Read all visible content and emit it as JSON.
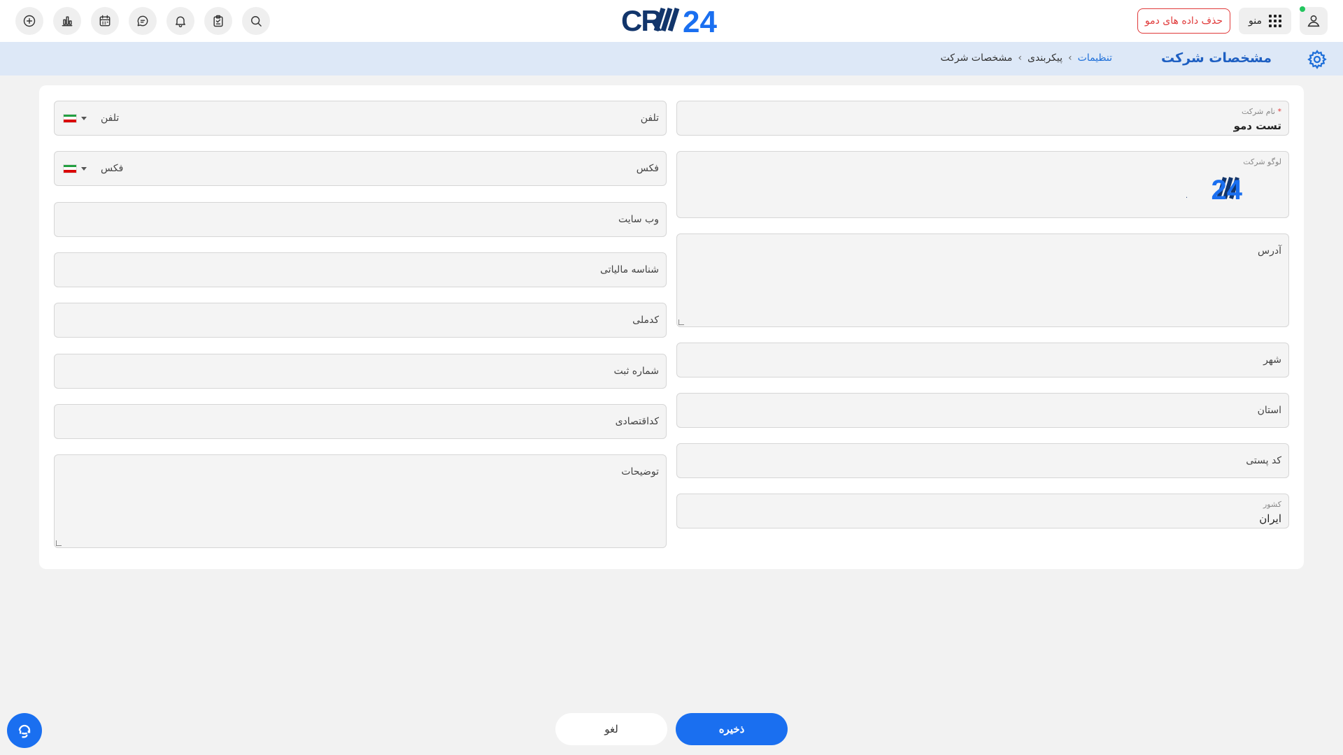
{
  "header": {
    "logo_text": "CRM24",
    "menu_label": "منو",
    "delete_demo_label": "حذف داده های دمو",
    "icons": [
      "add-icon",
      "chart-icon",
      "calendar-icon",
      "chat-icon",
      "bell-icon",
      "clipboard-icon",
      "search-icon"
    ]
  },
  "breadcrumb_bar": {
    "title": "مشخصات شرکت",
    "crumbs": [
      "تنظیمات",
      "پیکربندی",
      "مشخصات شرکت"
    ],
    "separator": "›"
  },
  "form": {
    "company_name": {
      "label": "نام شرکت",
      "required_mark": "*",
      "value": "تست دمو"
    },
    "company_logo": {
      "label": "لوگو شرکت",
      "logo_text": "CRM24"
    },
    "address": {
      "placeholder": "آدرس"
    },
    "city": {
      "placeholder": "شهر"
    },
    "province": {
      "placeholder": "استان"
    },
    "postal_code": {
      "placeholder": "کد پستی"
    },
    "country": {
      "label": "کشور",
      "value": "ایران"
    },
    "phone": {
      "placeholder": "تلفن",
      "prefix_label": "تلفن"
    },
    "fax": {
      "placeholder": "فکس",
      "prefix_label": "فکس"
    },
    "website": {
      "placeholder": "وب سایت"
    },
    "tax_id": {
      "placeholder": "شناسه مالیاتی"
    },
    "national_code": {
      "placeholder": "کدملی"
    },
    "registration_number": {
      "placeholder": "شماره ثبت"
    },
    "economic_code": {
      "placeholder": "کداقتصادی"
    },
    "description": {
      "placeholder": "توضیحات"
    }
  },
  "actions": {
    "save_label": "ذخیره",
    "cancel_label": "لغو"
  },
  "colors": {
    "accent": "#1a6ff0",
    "danger": "#e03a3a",
    "online": "#22c55e",
    "flag_green": "#239f40",
    "flag_white": "#ffffff",
    "flag_red": "#da0000"
  }
}
